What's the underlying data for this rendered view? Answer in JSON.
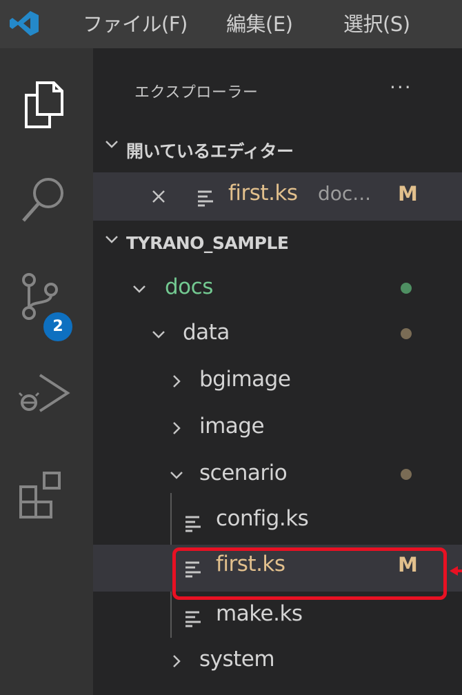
{
  "menu": {
    "items": [
      "ファイル(F)",
      "編集(E)",
      "選択(S)"
    ]
  },
  "activity_bar": {
    "icons": [
      "explorer-icon",
      "search-icon",
      "source-control-icon",
      "run-debug-icon",
      "extensions-icon"
    ],
    "source_control_badge": "2",
    "badge_color": "#0e70c0"
  },
  "sidebar": {
    "title": "エクスプローラー",
    "more": "···",
    "open_editors": {
      "header": "開いているエディター",
      "file": "first.ks",
      "desc": "doc...",
      "badge": "M"
    },
    "workspace": {
      "header": "TYRANO_SAMPLE",
      "tree": {
        "docs": "docs",
        "data": "data",
        "bgimage": "bgimage",
        "image": "image",
        "scenario": "scenario",
        "config": "config.ks",
        "first": "first.ks",
        "first_badge": "M",
        "make": "make.ks",
        "system": "system"
      }
    }
  },
  "colors": {
    "modified": "#e2c08d",
    "added": "#73c991",
    "highlight": "#e81123"
  }
}
